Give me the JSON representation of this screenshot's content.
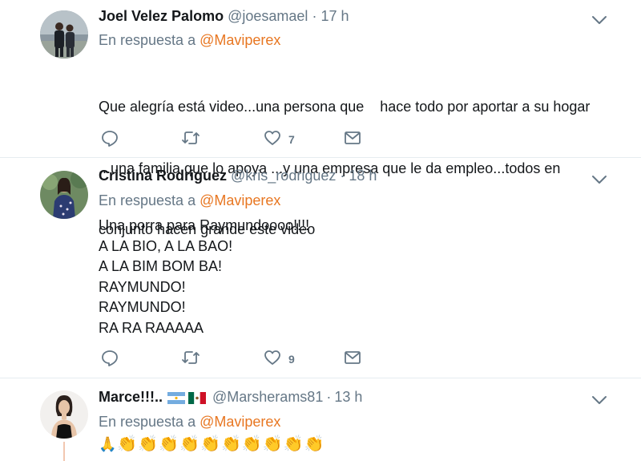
{
  "tweets": [
    {
      "name": "Joel Velez Palomo",
      "handle": "@joesamael",
      "time": "17 h",
      "reply_prefix": "En respuesta a",
      "reply_to": "@Maviperex",
      "lines": [
        "Que alegría está video...una persona que    hace todo por aportar a su hogar",
        "...una familia que lo apoya ...y una empresa que le da empleo...todos en",
        "conjunto hacen grande este video"
      ],
      "likes": "7"
    },
    {
      "name": "Cristina Rodriguez",
      "handle": "@kris_rodriguez",
      "time": "18 h",
      "reply_prefix": "En respuesta a",
      "reply_to": "@Maviperex",
      "lines": [
        "Una porra para Raymundoooo!!!!",
        "A LA BIO, A LA BAO!",
        "A LA BIM BOM BA!",
        "RAYMUNDO!",
        "RAYMUNDO!",
        "RA RA RAAAAA"
      ],
      "likes": "9"
    },
    {
      "name": "Marce!!!..",
      "flags": [
        "argentina-flag",
        "mexico-flag"
      ],
      "handle": "@Marsherams81",
      "time": "13 h",
      "reply_prefix": "En respuesta a",
      "reply_to": "@Maviperex",
      "emojis": [
        "folded-hands",
        "clap",
        "clap",
        "clap",
        "clap",
        "clap",
        "clap",
        "clap",
        "clap",
        "clap",
        "clap"
      ]
    }
  ],
  "colors": {
    "link": "#e87722",
    "muted": "#657786",
    "text": "#14171a",
    "divider": "#e6ecf0"
  },
  "icons": [
    "reply-icon",
    "retweet-icon",
    "like-icon",
    "dm-icon",
    "chevron-down-icon"
  ]
}
